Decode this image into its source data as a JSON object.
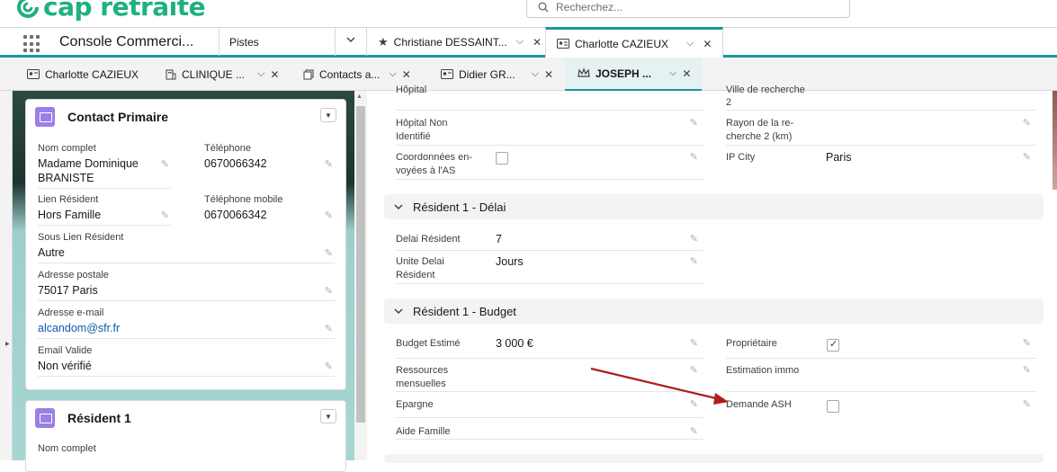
{
  "header": {
    "logo_text": "cap retraite",
    "search_placeholder": "Recherchez..."
  },
  "nav": {
    "app_name": "Console Commerci...",
    "object": "Pistes",
    "tabs": [
      {
        "label": "Christiane DESSAINT...",
        "icon": "person-star-icon"
      },
      {
        "label": "Charlotte CAZIEUX",
        "icon": "contact-card-icon",
        "active": true
      }
    ]
  },
  "subtabs": [
    {
      "label": "Charlotte CAZIEUX",
      "icon": "contact-card-icon"
    },
    {
      "label": "CLINIQUE ...",
      "icon": "building-icon"
    },
    {
      "label": "Contacts a...",
      "icon": "copy-icon"
    },
    {
      "label": "Didier GR...",
      "icon": "contact-card-icon"
    },
    {
      "label": "JOSEPH ...",
      "icon": "crown-icon",
      "active": true
    }
  ],
  "contact_card": {
    "title": "Contact Primaire",
    "fields": {
      "nom_complet_label": "Nom complet",
      "nom_complet": "Madame Dominique BRANISTE",
      "telephone_label": "Téléphone",
      "telephone": "0670066342",
      "lien_label": "Lien Résident",
      "lien": "Hors Famille",
      "mobile_label": "Téléphone mobile",
      "mobile": "0670066342",
      "sous_lien_label": "Sous Lien Résident",
      "sous_lien": "Autre",
      "adresse_label": "Adresse postale",
      "adresse": "75017 Paris",
      "email_label": "Adresse e-mail",
      "email": "alcandom@sfr.fr",
      "email_valide_label": "Email Valide",
      "email_valide": "Non vérifié"
    }
  },
  "resident_card": {
    "title": "Résident 1",
    "nom_complet_label": "Nom complet"
  },
  "detail": {
    "top_left_partial": "Hôpital",
    "top_right_partial": "Ville de recherche",
    "top_right_value": "2",
    "hopital_non_identifie": "Hôpital Non Identifié",
    "rayon": "Rayon de la re-cherche 2 (km)",
    "coordonnees": "Coordonnées en-voyées à l'AS",
    "ip_city_label": "IP City",
    "ip_city": "Paris",
    "section_delai": "Résident 1 - Délai",
    "delai_label": "Delai Résident",
    "delai": "7",
    "unite_label": "Unite Delai Résident",
    "unite": "Jours",
    "section_budget": "Résident 1 - Budget",
    "budget_label": "Budget Estimé",
    "budget": "3 000 €",
    "proprietaire_label": "Propriétaire",
    "proprietaire_checked": true,
    "ressources_label": "Ressources mensuelles",
    "estimation_label": "Estimation immo",
    "epargne_label": "Epargne",
    "demande_ash_label": "Demande ASH",
    "demande_ash_checked": false,
    "aide_label": "Aide Famille"
  },
  "colors": {
    "brand": "#1fb07f",
    "accent": "#1b96a0",
    "annotation_arrow": "#b01c1c"
  }
}
